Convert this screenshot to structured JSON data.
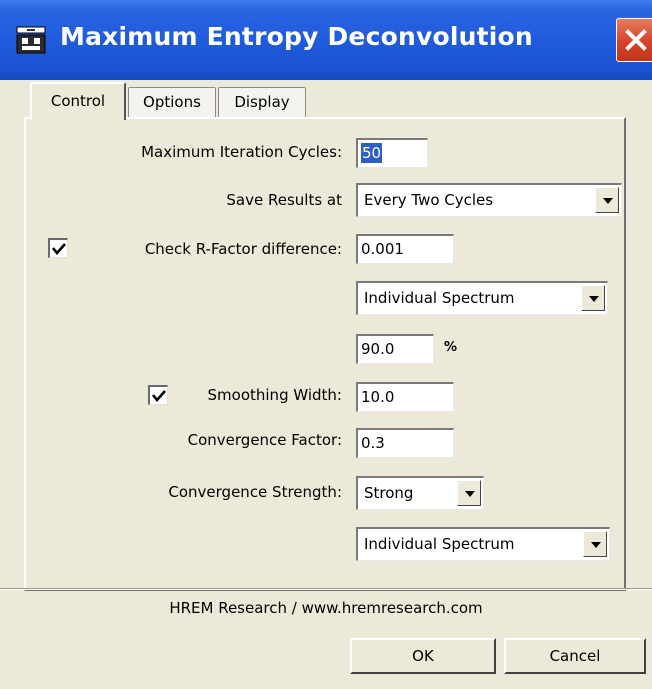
{
  "window": {
    "title": "Maximum Entropy Deconvolution",
    "icon": "app-icon",
    "close_icon": "close-icon"
  },
  "tabs": [
    {
      "label": "Control",
      "active": true
    },
    {
      "label": "Options",
      "active": false
    },
    {
      "label": "Display",
      "active": false
    }
  ],
  "control": {
    "max_iter_label": "Maximum Iteration Cycles:",
    "max_iter_value": "50",
    "save_results_label": "Save Results at",
    "save_results_value": "Every Two Cycles",
    "rfactor_checked": true,
    "rfactor_label": "Check R-Factor difference:",
    "rfactor_value": "0.001",
    "rfactor_mode": "Individual Spectrum",
    "percent_value": "90.0",
    "percent_unit": "%",
    "smoothing_checked": true,
    "smoothing_label": "Smoothing Width:",
    "smoothing_value": "10.0",
    "conv_factor_label": "Convergence Factor:",
    "conv_factor_value": "0.3",
    "conv_strength_label": "Convergence Strength:",
    "conv_strength_value": "Strong",
    "conv_mode": "Individual Spectrum"
  },
  "footer": {
    "credit": "HREM Research / www.hremresearch.com",
    "ok_label": "OK",
    "cancel_label": "Cancel"
  },
  "colors": {
    "titlebar": "#1f5bdc",
    "dialog_bg": "#ece9d8",
    "close_button": "#d6432a",
    "selection": "#2f5fc6"
  }
}
